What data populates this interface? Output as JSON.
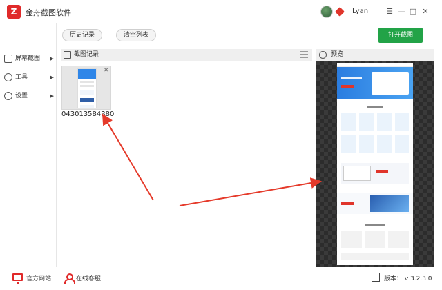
{
  "app": {
    "title": "金舟截图软件",
    "logo_text": "Z"
  },
  "user": {
    "name": "Lyan"
  },
  "window_controls": {
    "menu": "☰",
    "minimize": "—",
    "maximize": "□",
    "close": "✕"
  },
  "sidebar": {
    "items": [
      {
        "label": "屏幕截图",
        "icon": "screen-capture-icon"
      },
      {
        "label": "工具",
        "icon": "tools-icon"
      },
      {
        "label": "设置",
        "icon": "gear-icon"
      }
    ],
    "chevron": "▶"
  },
  "toolbar": {
    "history_label": "历史记录",
    "clear_label": "清空列表",
    "open_label": "打开截图"
  },
  "records_panel": {
    "title": "截图记录"
  },
  "thumbnails": [
    {
      "name": "043013584380",
      "close": "✕"
    }
  ],
  "preview_panel": {
    "title": "预览"
  },
  "status": {
    "website": "官方网站",
    "support": "在线客服",
    "version": "版本： v 3.2.3.0"
  },
  "colors": {
    "accent_green": "#22a347",
    "brand_red": "#e02a2a",
    "arrow_red": "#e53a2a"
  }
}
